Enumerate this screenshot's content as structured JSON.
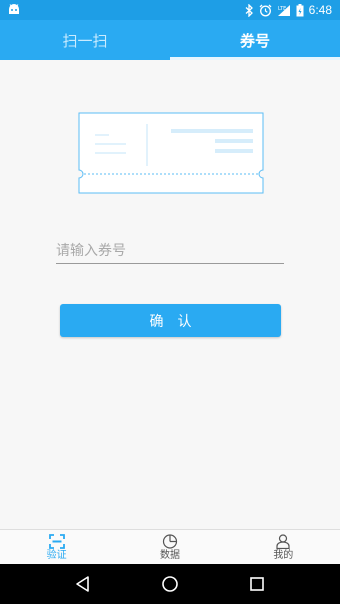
{
  "status_bar": {
    "time": "6:48",
    "icons": [
      "android-icon",
      "bluetooth-icon",
      "alarm-icon",
      "lte-signal-icon",
      "battery-icon"
    ],
    "lte_label": "LTE",
    "bg_color": "#1e9ee6"
  },
  "tabs": [
    {
      "label": "扫一扫",
      "active": false
    },
    {
      "label": "券号",
      "active": true
    }
  ],
  "form": {
    "placeholder": "请输入券号",
    "value": "",
    "confirm_label": "确　认"
  },
  "bottom_nav": [
    {
      "label": "验证",
      "icon": "scan-verify-icon",
      "active": true
    },
    {
      "label": "数据",
      "icon": "pie-chart-icon",
      "active": false
    },
    {
      "label": "我的",
      "icon": "person-icon",
      "active": false
    }
  ],
  "system_nav": [
    "back-icon",
    "home-icon",
    "recents-icon"
  ],
  "colors": {
    "accent": "#2aaaf2",
    "page_bg": "#f7f7f7",
    "ticket_outline": "#5bbcf5"
  }
}
